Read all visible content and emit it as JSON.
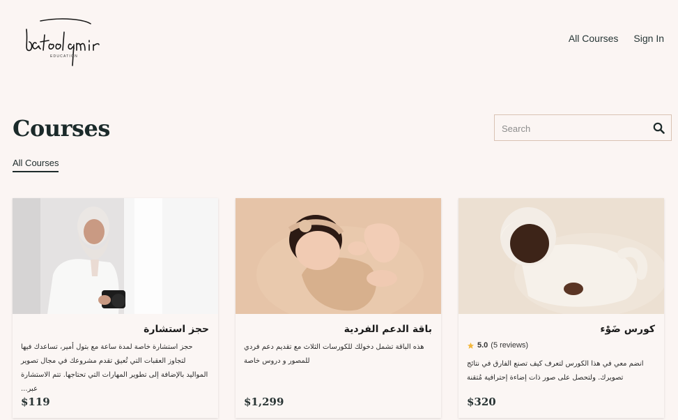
{
  "brand": {
    "logo_text": "batool amir",
    "logo_sub": "EDUCATION"
  },
  "nav": {
    "all_courses": "All Courses",
    "sign_in": "Sign In"
  },
  "page": {
    "title": "Courses",
    "filter_tab": "All Courses"
  },
  "search": {
    "placeholder": "Search"
  },
  "colors": {
    "background": "#fbf5f3",
    "accent": "#1e2b2b",
    "search_border": "#d9c2b3",
    "star": "#f3b73b"
  },
  "courses": [
    {
      "title": "حجز استشارة",
      "description": "حجز استشارة خاصة لمدة ساعة مع بتول أمير، تساعدك فيها لتجاوز العقبات التي تُعيق تقدم مشروعك في مجال تصوير المواليد بالإضافة إلى تطوير المهارات التي تحتاجها. تتم الاستشارة عبر...",
      "price": "$119",
      "image": "woman-with-camera"
    },
    {
      "title": "باقة الدعم الفردية",
      "description": "هذه الباقة تشمل دخولك للكورسات الثلاث مع تقديم دعم فردي للمصور و دروس خاصة",
      "price": "$1,299",
      "image": "newborn-with-headband"
    },
    {
      "title": "كورس ضَوْء",
      "rating": "5.0",
      "reviews": "(5 reviews)",
      "description": "انضم معي في هذا الكورس لتعرف كيف تصنع الفارق في نتائج تصويرك. ولتحصل على صور ذات إضاءة إحترافية مُتقنة",
      "price": "$320",
      "image": "newborn-in-bonnet"
    }
  ]
}
